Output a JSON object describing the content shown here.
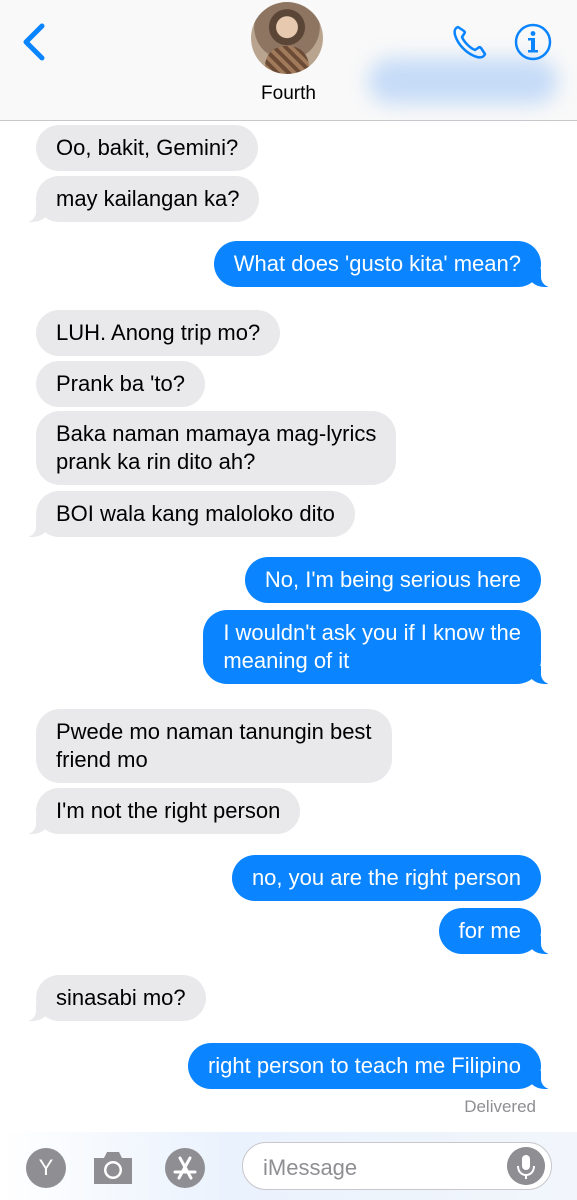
{
  "header": {
    "contact_name": "Fourth"
  },
  "messages": [
    {
      "dir": "recv",
      "text": "Oo, bakit, Gemini?"
    },
    {
      "dir": "recv",
      "text": "may kailangan ka?"
    },
    {
      "dir": "sent",
      "text": "What does 'gusto kita' mean?"
    },
    {
      "dir": "recv",
      "text": "LUH. Anong trip mo?"
    },
    {
      "dir": "recv",
      "text": "Prank ba 'to?"
    },
    {
      "dir": "recv",
      "text": "Baka naman mamaya mag-lyrics\nprank ka rin dito ah?"
    },
    {
      "dir": "recv",
      "text": "BOI wala kang maloloko dito"
    },
    {
      "dir": "sent",
      "text": "No, I'm being serious here"
    },
    {
      "dir": "sent",
      "text": "I wouldn't ask you if I know the\nmeaning of it"
    },
    {
      "dir": "recv",
      "text": "Pwede mo naman tanungin best\nfriend mo"
    },
    {
      "dir": "recv",
      "text": "I'm not the right person"
    },
    {
      "dir": "sent",
      "text": "no, you are the right person"
    },
    {
      "dir": "sent",
      "text": "for me"
    },
    {
      "dir": "recv",
      "text": "sinasabi mo?"
    },
    {
      "dir": "sent",
      "text": "right person to teach me Filipino"
    }
  ],
  "status": {
    "delivered": "Delivered"
  },
  "compose": {
    "app_drawer_letter": "Y",
    "placeholder": "iMessage"
  },
  "colors": {
    "accent": "#0a84ff",
    "received_bubble": "#e9e9eb",
    "secondary_text": "#8e8e93"
  }
}
